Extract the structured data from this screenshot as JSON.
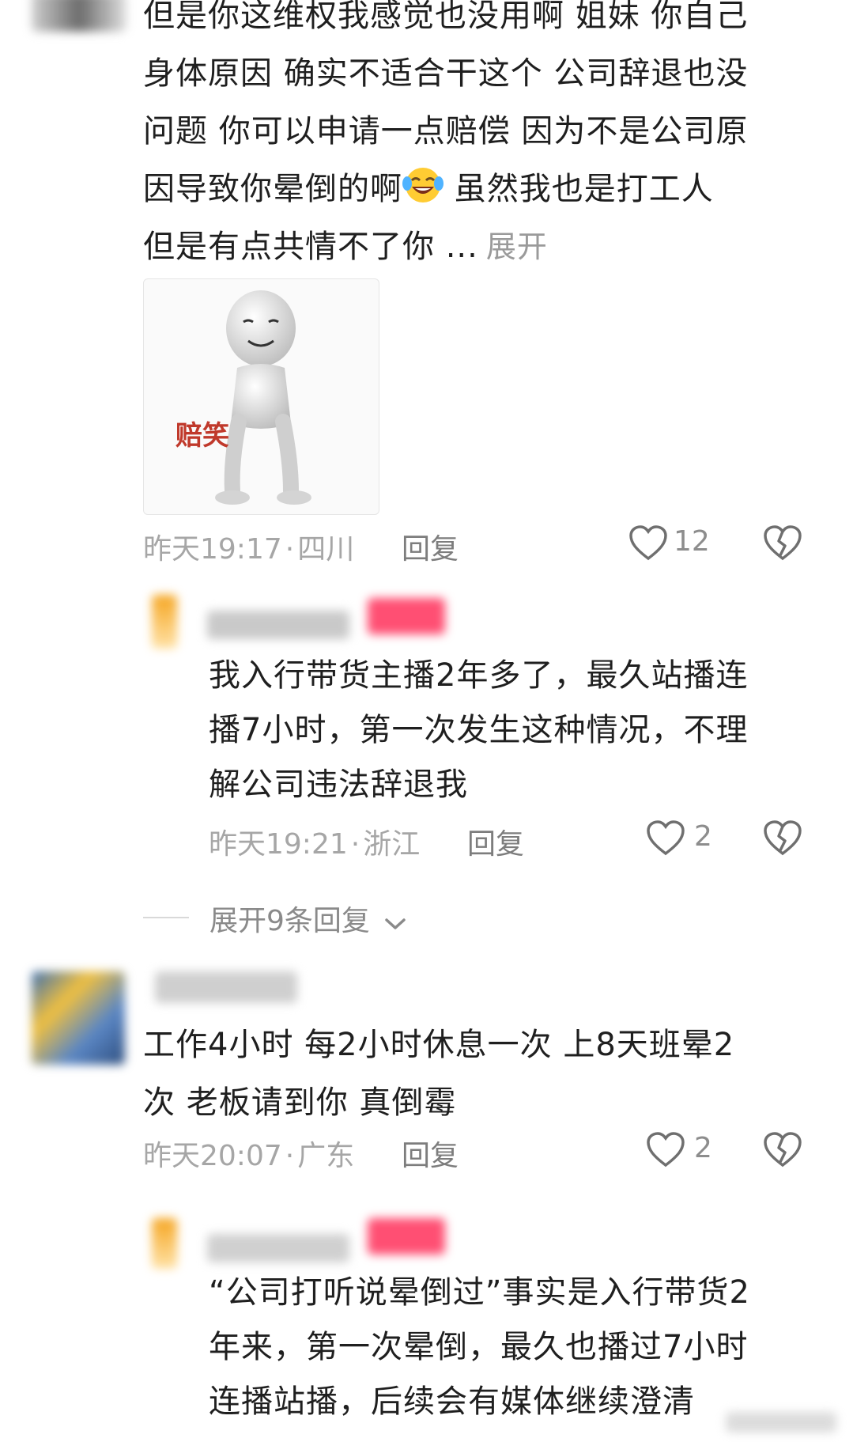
{
  "comments": [
    {
      "text_lines": [
        "但是你这维权我感觉也没用啊 姐妹 你自己",
        "身体原因 确实不适合干这个 公司辞退也没",
        "问题 你可以申请一点赔偿 因为不是公司原",
        "因导致你晕倒的啊",
        "但是有点共情不了你 ..."
      ],
      "emoji_icon": "laughing-tears-emoji",
      "after_emoji_text": " 虽然我也是打工人",
      "expand_label": "展开",
      "sticker_caption": "赔笑",
      "time": "昨天19:17",
      "location": "四川",
      "reply_label": "回复",
      "likes": "12"
    },
    {
      "text_lines": [
        "工作4小时 每2小时休息一次  上8天班晕2",
        "次 老板请到你 真倒霉"
      ],
      "time": "昨天20:07",
      "location": "广东",
      "reply_label": "回复",
      "likes": "2"
    }
  ],
  "replies": [
    {
      "text_lines": [
        "我入行带货主播2年多了，最久站播连",
        "播7小时，第一次发生这种情况，不理",
        "解公司违法辞退我"
      ],
      "time": "昨天19:21",
      "location": "浙江",
      "reply_label": "回复",
      "likes": "2"
    },
    {
      "text_lines": [
        "“公司打听说晕倒过”事实是入行带货2",
        "年来，第一次晕倒，最久也播过7小时",
        "连播站播，后续会有媒体继续澄清"
      ]
    }
  ],
  "thread": {
    "expand_replies_label": "展开9条回复"
  },
  "meta_separator": "·",
  "colors": {
    "text": "#1f1f1f",
    "meta": "#a6a6a6",
    "badge": "#ff4f73",
    "background": "#ffffff"
  }
}
